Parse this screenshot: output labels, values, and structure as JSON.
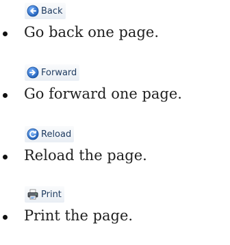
{
  "items": [
    {
      "icon": "back-arrow-icon",
      "label": "Back",
      "description": "Go back one page."
    },
    {
      "icon": "forward-arrow-icon",
      "label": "Forward",
      "description": "Go forward one page."
    },
    {
      "icon": "reload-icon",
      "label": "Reload",
      "description": "Reload the page."
    },
    {
      "icon": "printer-icon",
      "label": "Print",
      "description": "Print the page."
    }
  ],
  "colors": {
    "icon_blue": "#2f6fc8",
    "label_text": "#1e3a5f",
    "button_bg": "#eef2f7"
  }
}
